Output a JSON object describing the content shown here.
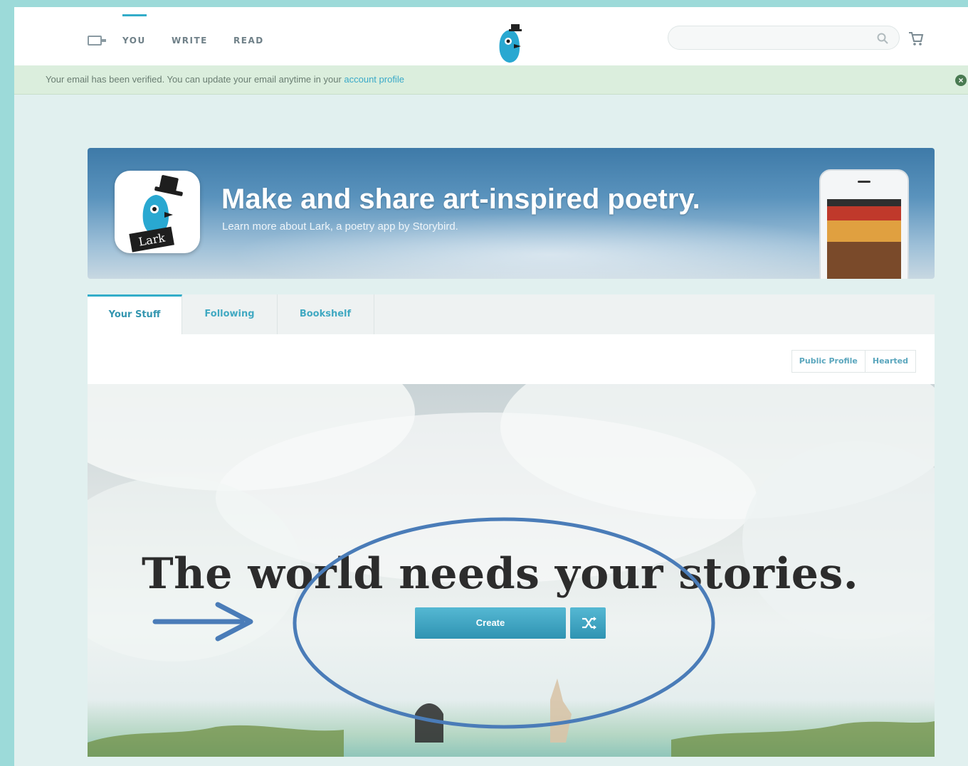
{
  "nav": {
    "links": [
      "YOU",
      "WRITE",
      "READ"
    ],
    "search_placeholder": ""
  },
  "notice": {
    "text": "Your email has been verified. You can update your email anytime in your ",
    "link": "account profile"
  },
  "banner": {
    "title": "Make and share art-inspired poetry.",
    "subtitle": "Learn more about Lark, a poetry app by Storybird.",
    "app_label": "Lark"
  },
  "tabs": [
    "Your Stuff",
    "Following",
    "Bookshelf"
  ],
  "profile_buttons": [
    "Public Profile",
    "Hearted"
  ],
  "hero": {
    "title": "The world needs your stories.",
    "create_label": "Create"
  },
  "colors": {
    "accent": "#33adc9",
    "annotation": "#4a7cb8",
    "frame": "#9cdad9"
  },
  "icons": [
    "book-icon",
    "logo-bird-icon",
    "search-icon",
    "cart-icon",
    "close-icon",
    "shuffle-icon",
    "arrow-icon"
  ]
}
